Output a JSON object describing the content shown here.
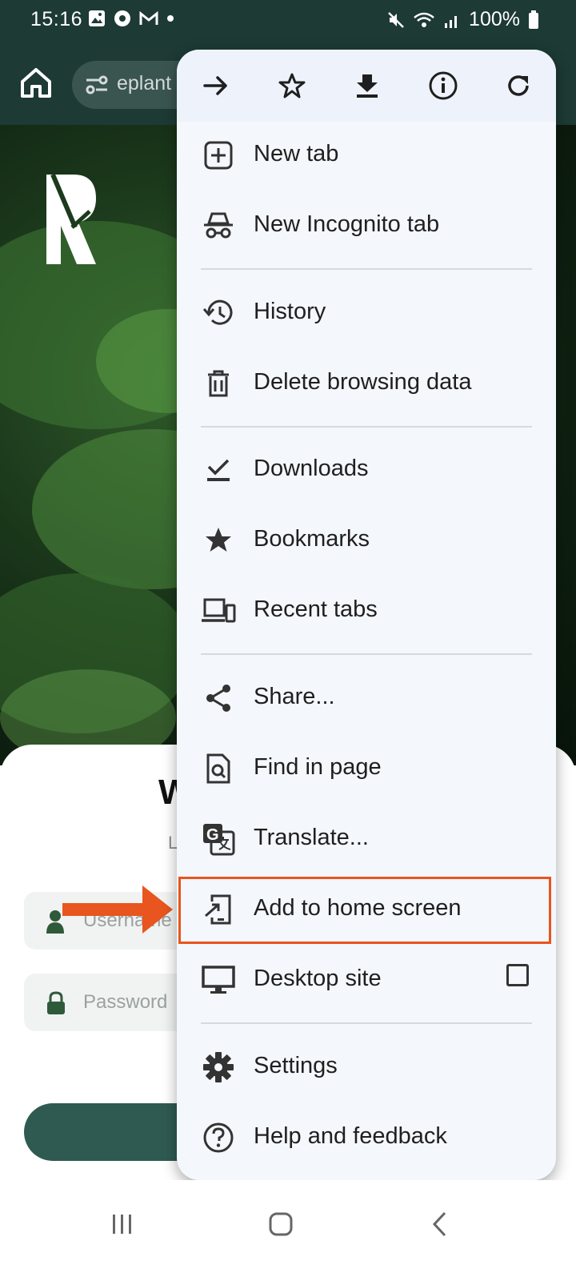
{
  "status_bar": {
    "time": "15:16",
    "battery": "100%",
    "icons_left": [
      "gallery-icon",
      "chrome-icon",
      "gmail-icon",
      "dot-icon"
    ],
    "icons_right": [
      "mute-icon",
      "wifi-icon",
      "signal-icon",
      "battery-icon"
    ]
  },
  "toolbar": {
    "url_text": "eplant"
  },
  "page": {
    "title_visible": "W",
    "subtitle_visible": "L",
    "username_placeholder": "Username",
    "password_placeholder": "Password"
  },
  "menu": {
    "top_actions": [
      "forward-icon",
      "bookmark-star-icon",
      "download-icon",
      "info-icon",
      "refresh-icon"
    ],
    "items": [
      {
        "label": "New tab",
        "icon": "new-tab-icon"
      },
      {
        "label": "New Incognito tab",
        "icon": "incognito-icon"
      },
      {
        "label": "History",
        "icon": "history-icon"
      },
      {
        "label": "Delete browsing data",
        "icon": "trash-icon"
      },
      {
        "label": "Downloads",
        "icon": "downloads-icon"
      },
      {
        "label": "Bookmarks",
        "icon": "star-icon"
      },
      {
        "label": "Recent tabs",
        "icon": "devices-icon"
      },
      {
        "label": "Share...",
        "icon": "share-icon"
      },
      {
        "label": "Find in page",
        "icon": "find-icon"
      },
      {
        "label": "Translate...",
        "icon": "translate-icon"
      },
      {
        "label": "Add to home screen",
        "icon": "add-to-home-icon"
      },
      {
        "label": "Desktop site",
        "icon": "desktop-icon"
      },
      {
        "label": "Settings",
        "icon": "settings-icon"
      },
      {
        "label": "Help and feedback",
        "icon": "help-icon"
      }
    ],
    "highlight_color": "#e8551e"
  },
  "colors": {
    "browser_bar": "#1d3a35",
    "menu_bg": "#f4f7fc",
    "arrow": "#e8551e",
    "accent_green": "#2f5a52"
  }
}
